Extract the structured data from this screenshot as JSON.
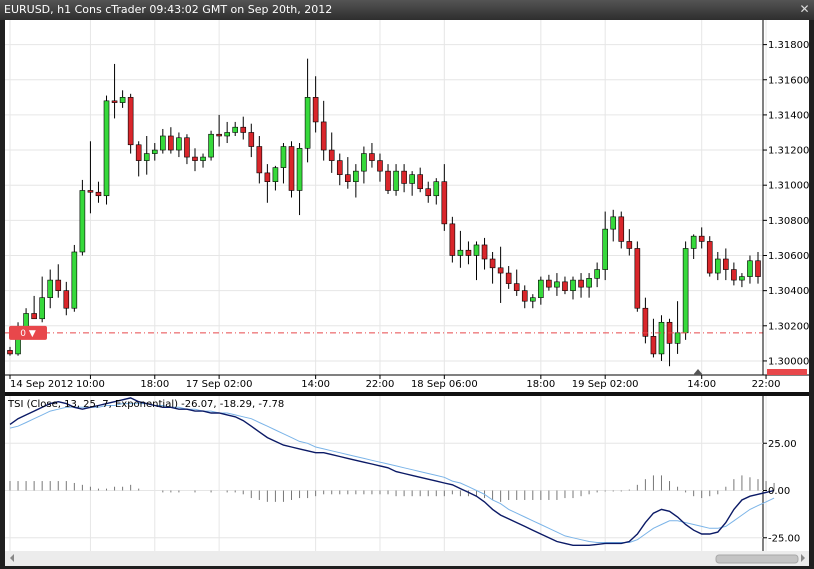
{
  "window": {
    "title": "EURUSD, h1 Cons cTrader 09:43:02 GMT on Sep 20th, 2012",
    "close_glyph": "✕"
  },
  "price_marker": {
    "text": "0 ▼",
    "price": 1.3016,
    "color": "#e8474b"
  },
  "indicator": {
    "label": "TSI (Close, 13, 25, 7, Exponential) -26.07, -18.29, -7.78",
    "y_ticks": [
      "25.00",
      "0.00",
      "-25.00"
    ],
    "y_tick_values": [
      25,
      0,
      -25
    ]
  },
  "colors": {
    "bull": "#36d93b",
    "bear": "#d9262b",
    "tsi_line": "#0b1a66",
    "signal_line": "#7bb4e8",
    "histogram": "#777777",
    "price_line": "#e8474b",
    "grid": "#e6e6e6",
    "background": "#ffffff",
    "panel_bg": "#ffffff"
  },
  "chart_data": [
    {
      "type": "candlestick",
      "title": "EURUSD, h1 Cons cTrader 09:43:02 GMT on Sep 20th, 2012",
      "ylim": [
        1.2992,
        1.3194
      ],
      "y_ticks": [
        "1.31800",
        "1.31600",
        "1.31400",
        "1.31200",
        "1.31000",
        "1.30800",
        "1.30600",
        "1.30400",
        "1.30200",
        "1.30000"
      ],
      "y_tick_values": [
        1.318,
        1.316,
        1.314,
        1.312,
        1.31,
        1.308,
        1.306,
        1.304,
        1.302,
        1.3
      ],
      "x_ticks": [
        "14 Sep 2012",
        "10:00",
        "18:00",
        "17 Sep 02:00",
        "14:00",
        "22:00",
        "18 Sep 06:00",
        "18:00",
        "19 Sep 02:00",
        "14:00",
        "22:00"
      ],
      "x_tick_bar_index": [
        0,
        10,
        18,
        26,
        38,
        46,
        54,
        66,
        74,
        86,
        94
      ],
      "ohlc": [
        [
          1.3006,
          1.3008,
          1.3003,
          1.3004
        ],
        [
          1.3004,
          1.3022,
          1.3003,
          1.3019
        ],
        [
          1.3019,
          1.303,
          1.3016,
          1.3027
        ],
        [
          1.3027,
          1.3037,
          1.3024,
          1.3024
        ],
        [
          1.3024,
          1.3048,
          1.3022,
          1.3036
        ],
        [
          1.3036,
          1.3052,
          1.303,
          1.3046
        ],
        [
          1.3046,
          1.3055,
          1.3036,
          1.304
        ],
        [
          1.304,
          1.3045,
          1.3026,
          1.303
        ],
        [
          1.303,
          1.3066,
          1.3028,
          1.3062
        ],
        [
          1.3062,
          1.3103,
          1.306,
          1.3097
        ],
        [
          1.3097,
          1.3125,
          1.3084,
          1.3096
        ],
        [
          1.3096,
          1.3102,
          1.309,
          1.3094
        ],
        [
          1.3094,
          1.3151,
          1.3089,
          1.3148
        ],
        [
          1.3148,
          1.3169,
          1.3138,
          1.3147
        ],
        [
          1.3147,
          1.3154,
          1.3144,
          1.315
        ],
        [
          1.315,
          1.3152,
          1.3118,
          1.3123
        ],
        [
          1.3123,
          1.3125,
          1.3105,
          1.3114
        ],
        [
          1.3114,
          1.3128,
          1.3106,
          1.3118
        ],
        [
          1.3118,
          1.3124,
          1.3114,
          1.312
        ],
        [
          1.312,
          1.3132,
          1.3118,
          1.3128
        ],
        [
          1.3128,
          1.3133,
          1.3118,
          1.312
        ],
        [
          1.312,
          1.313,
          1.3116,
          1.3127
        ],
        [
          1.3127,
          1.3129,
          1.3112,
          1.3116
        ],
        [
          1.3116,
          1.3121,
          1.3108,
          1.3114
        ],
        [
          1.3114,
          1.3118,
          1.311,
          1.3116
        ],
        [
          1.3116,
          1.3131,
          1.3114,
          1.3129
        ],
        [
          1.3129,
          1.314,
          1.3122,
          1.3128
        ],
        [
          1.3128,
          1.3136,
          1.3124,
          1.313
        ],
        [
          1.313,
          1.3136,
          1.3128,
          1.3133
        ],
        [
          1.3133,
          1.3139,
          1.3126,
          1.313
        ],
        [
          1.313,
          1.3135,
          1.3116,
          1.3122
        ],
        [
          1.3122,
          1.3128,
          1.3101,
          1.3107
        ],
        [
          1.3107,
          1.3112,
          1.309,
          1.3102
        ],
        [
          1.3102,
          1.3111,
          1.3097,
          1.311
        ],
        [
          1.311,
          1.3124,
          1.3101,
          1.3122
        ],
        [
          1.3122,
          1.3125,
          1.3093,
          1.3097
        ],
        [
          1.3097,
          1.3124,
          1.3083,
          1.3121
        ],
        [
          1.3121,
          1.3172,
          1.3113,
          1.315
        ],
        [
          1.315,
          1.3162,
          1.313,
          1.3136
        ],
        [
          1.3136,
          1.3148,
          1.3114,
          1.312
        ],
        [
          1.312,
          1.313,
          1.3107,
          1.3114
        ],
        [
          1.3114,
          1.3118,
          1.31,
          1.3106
        ],
        [
          1.3106,
          1.3116,
          1.3098,
          1.3102
        ],
        [
          1.3102,
          1.3112,
          1.3093,
          1.3108
        ],
        [
          1.3108,
          1.3122,
          1.3101,
          1.3118
        ],
        [
          1.3118,
          1.3124,
          1.311,
          1.3114
        ],
        [
          1.3114,
          1.3118,
          1.3102,
          1.3108
        ],
        [
          1.3108,
          1.3112,
          1.3095,
          1.3097
        ],
        [
          1.3097,
          1.3112,
          1.3094,
          1.3108
        ],
        [
          1.3108,
          1.3112,
          1.3096,
          1.3101
        ],
        [
          1.3101,
          1.3108,
          1.3094,
          1.3106
        ],
        [
          1.3106,
          1.311,
          1.3096,
          1.3098
        ],
        [
          1.3098,
          1.3102,
          1.309,
          1.3094
        ],
        [
          1.3094,
          1.3104,
          1.3089,
          1.3102
        ],
        [
          1.3102,
          1.3112,
          1.3074,
          1.3078
        ],
        [
          1.3078,
          1.3082,
          1.3056,
          1.306
        ],
        [
          1.306,
          1.3074,
          1.3053,
          1.3063
        ],
        [
          1.3063,
          1.3068,
          1.3055,
          1.306
        ],
        [
          1.306,
          1.3068,
          1.3046,
          1.3066
        ],
        [
          1.3066,
          1.307,
          1.3052,
          1.3058
        ],
        [
          1.3058,
          1.3062,
          1.3044,
          1.3053
        ],
        [
          1.3053,
          1.3065,
          1.3033,
          1.305
        ],
        [
          1.305,
          1.3054,
          1.3041,
          1.3044
        ],
        [
          1.3044,
          1.3052,
          1.3037,
          1.304
        ],
        [
          1.304,
          1.3043,
          1.303,
          1.3034
        ],
        [
          1.3034,
          1.3038,
          1.303,
          1.3036
        ],
        [
          1.3036,
          1.3048,
          1.3032,
          1.3046
        ],
        [
          1.3046,
          1.3049,
          1.304,
          1.3042
        ],
        [
          1.3042,
          1.305,
          1.3037,
          1.3045
        ],
        [
          1.3045,
          1.3048,
          1.3038,
          1.304
        ],
        [
          1.304,
          1.3048,
          1.3035,
          1.3046
        ],
        [
          1.3046,
          1.305,
          1.3036,
          1.3042
        ],
        [
          1.3042,
          1.305,
          1.3036,
          1.3047
        ],
        [
          1.3047,
          1.3056,
          1.3042,
          1.3052
        ],
        [
          1.3052,
          1.3085,
          1.3046,
          1.3075
        ],
        [
          1.3075,
          1.3086,
          1.3068,
          1.3082
        ],
        [
          1.3082,
          1.3085,
          1.3064,
          1.3068
        ],
        [
          1.3068,
          1.3075,
          1.306,
          1.3064
        ],
        [
          1.3064,
          1.3068,
          1.3028,
          1.303
        ],
        [
          1.303,
          1.3036,
          1.301,
          1.3014
        ],
        [
          1.3014,
          1.3024,
          1.3002,
          1.3004
        ],
        [
          1.3004,
          1.3026,
          1.3,
          1.3022
        ],
        [
          1.3022,
          1.3024,
          1.2997,
          1.301
        ],
        [
          1.301,
          1.3034,
          1.3004,
          1.3016
        ],
        [
          1.3016,
          1.3068,
          1.3012,
          1.3064
        ],
        [
          1.3064,
          1.3072,
          1.3058,
          1.3071
        ],
        [
          1.3071,
          1.3076,
          1.3064,
          1.3068
        ],
        [
          1.3068,
          1.3071,
          1.3048,
          1.305
        ],
        [
          1.305,
          1.3062,
          1.3046,
          1.3058
        ],
        [
          1.3058,
          1.3064,
          1.3046,
          1.3052
        ],
        [
          1.3052,
          1.3056,
          1.3043,
          1.3046
        ],
        [
          1.3046,
          1.305,
          1.3042,
          1.3048
        ],
        [
          1.3048,
          1.306,
          1.3044,
          1.3057
        ],
        [
          1.3057,
          1.3062,
          1.3044,
          1.3048
        ]
      ]
    },
    {
      "type": "line",
      "title": "TSI (Close, 13, 25, 7, Exponential) -26.07, -18.29, -7.78",
      "ylim": [
        -32,
        50
      ],
      "x_tick_bar_index": [
        0,
        10,
        18,
        26,
        38,
        46,
        54,
        66,
        74,
        86,
        94
      ],
      "series": [
        {
          "name": "",
          "values": [
            35,
            38,
            40,
            42,
            44,
            46,
            47,
            46,
            44,
            43,
            44,
            45,
            46,
            47,
            48,
            49,
            47,
            46,
            45,
            44,
            44,
            43,
            43,
            42,
            42,
            41,
            41,
            40,
            39,
            37,
            34,
            31,
            28,
            26,
            24,
            23,
            22,
            21,
            20,
            20,
            19,
            18,
            17,
            16,
            15,
            14,
            13,
            12,
            10,
            9,
            8,
            7,
            6,
            5,
            4,
            3,
            1,
            -1,
            -3,
            -6,
            -10,
            -13,
            -15,
            -17,
            -19,
            -21,
            -23,
            -25,
            -27,
            -28,
            -29,
            -29,
            -29,
            -28.5,
            -28,
            -28,
            -28,
            -27,
            -23,
            -17,
            -12,
            -10,
            -11,
            -14,
            -18,
            -21,
            -23,
            -23,
            -22,
            -17,
            -10,
            -5,
            -3,
            -2,
            -1,
            0
          ]
        },
        {
          "name": "",
          "values": [
            33,
            34,
            36,
            38,
            40,
            42,
            43,
            44,
            44,
            44,
            44,
            44,
            45,
            45,
            46,
            46,
            46,
            46,
            45,
            45,
            44,
            44,
            43,
            43,
            42,
            42,
            41,
            41,
            40,
            39,
            38,
            36,
            34,
            32,
            30,
            28,
            26,
            25,
            23,
            22,
            21,
            20,
            19,
            18,
            17,
            16,
            15,
            14,
            13,
            12,
            11,
            10,
            9,
            8,
            7,
            5,
            4,
            2,
            0,
            -2,
            -5,
            -7,
            -10,
            -12,
            -14,
            -16,
            -18,
            -20,
            -22,
            -24,
            -25,
            -26,
            -27,
            -27.5,
            -27.5,
            -27.5,
            -27.5,
            -27.5,
            -26,
            -23,
            -20,
            -18,
            -16,
            -16,
            -17,
            -18,
            -19,
            -20,
            -20,
            -19,
            -16,
            -13,
            -10,
            -8,
            -6,
            -4
          ]
        },
        {
          "name": "",
          "type": "histogram",
          "values": [
            5,
            5,
            5,
            5,
            5,
            5,
            5,
            5,
            4,
            3,
            2,
            1,
            1,
            2,
            2,
            3,
            1,
            0,
            0,
            -1,
            -1,
            -1,
            0,
            -1,
            0,
            -1,
            0,
            -1,
            -1,
            -2,
            -4,
            -5,
            -6,
            -6,
            -6,
            -5,
            -4,
            -4,
            -3,
            -2,
            -2,
            -2,
            -2,
            -2,
            -2,
            -2,
            -2,
            -2,
            -3,
            -3,
            -3,
            -3,
            -3,
            -3,
            -3,
            -2,
            -3,
            -3,
            -3,
            -4,
            -5,
            -6,
            -5,
            -5,
            -5,
            -5,
            -5,
            -5,
            -5,
            -4,
            -4,
            -3,
            -2,
            -1,
            -0.5,
            -0.5,
            -0.5,
            0.5,
            3,
            6,
            8,
            8,
            5,
            2,
            -1,
            -3,
            -4,
            -3,
            -2,
            2,
            6,
            8,
            7,
            6,
            5,
            4
          ]
        }
      ]
    }
  ]
}
